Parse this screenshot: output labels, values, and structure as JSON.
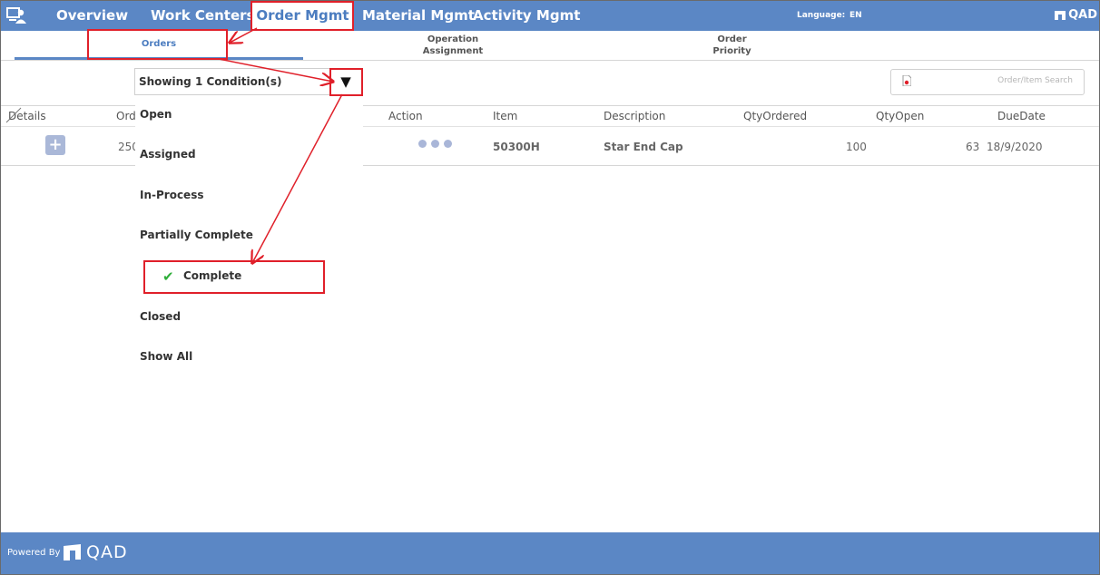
{
  "topbar": {
    "app_icon": "monitor-user-icon",
    "tabs": [
      "Overview",
      "Work Centers",
      "Order Mgmt",
      "Material Mgmt",
      "Activity Mgmt"
    ],
    "active_tab": "Order Mgmt",
    "language_label": "Language:",
    "language_value": "EN",
    "brand": "QAD"
  },
  "subnav": {
    "tabs": [
      {
        "line1": "Orders",
        "line2": ""
      },
      {
        "line1": "Operation",
        "line2": "Assignment"
      },
      {
        "line1": "Order",
        "line2": "Priority"
      }
    ]
  },
  "filter": {
    "label": "Showing 1 Condition(s)",
    "arrow": "▼"
  },
  "search": {
    "placeholder": "Order/Item Search",
    "icon": "pdf-icon"
  },
  "table": {
    "headers": [
      "Details",
      "Ord",
      "Action",
      "Item",
      "Description",
      "QtyOrdered",
      "QtyOpen",
      "DueDate"
    ],
    "rows": [
      {
        "order": "250",
        "item": "50300H",
        "description": "Star End Cap",
        "qty_ordered": "100",
        "qty_open": "63",
        "due_date": "18/9/2020"
      }
    ]
  },
  "menu": {
    "items": [
      "Open",
      "Assigned",
      "In-Process",
      "Partially Complete",
      "Complete",
      "Closed",
      "Show All"
    ],
    "selected": "Complete"
  },
  "footer": {
    "powered_by": "Powered By",
    "brand": "QAD"
  },
  "colors": {
    "header_blue": "#5b87c5",
    "annotation_red": "#e0202a",
    "check_green": "#2fae3a"
  }
}
